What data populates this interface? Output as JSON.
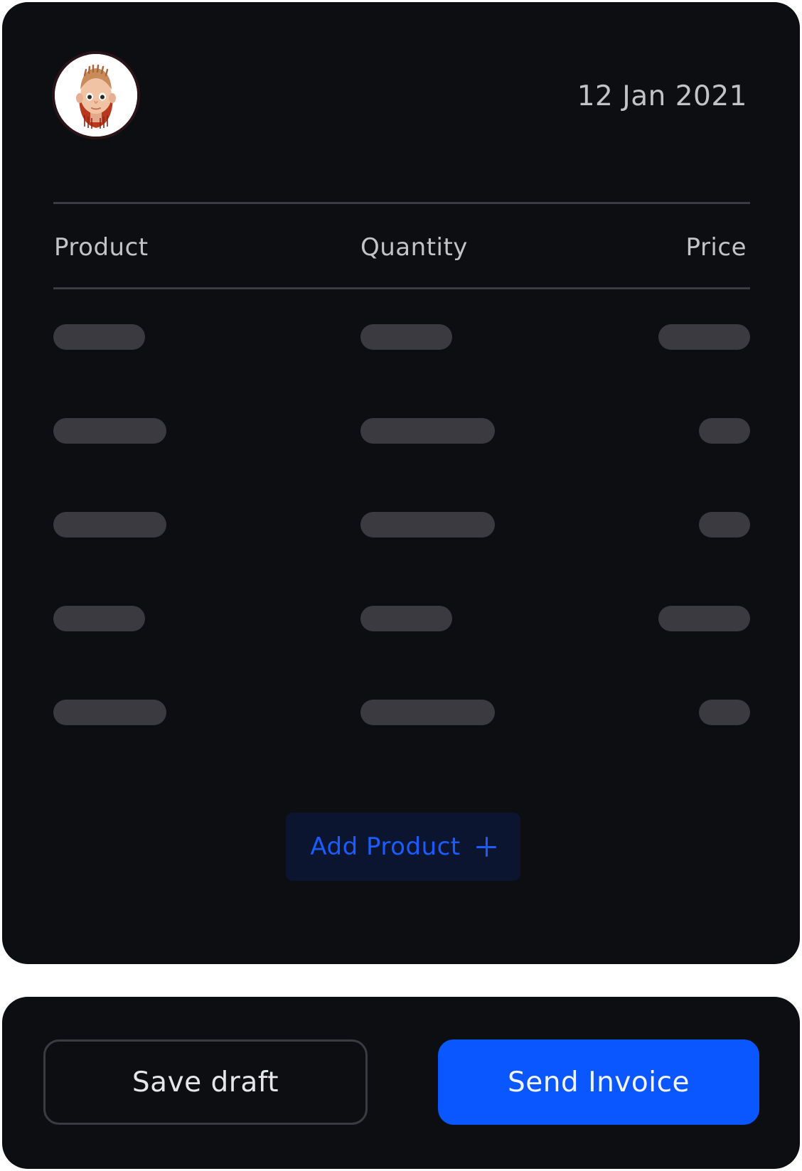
{
  "invoice": {
    "date": "12 Jan 2021",
    "avatar_alt": "",
    "columns": {
      "product": "Product",
      "quantity": "Quantity",
      "price": "Price"
    },
    "rows_state": "loading-placeholder",
    "add_product_label": "Add Product"
  },
  "actions": {
    "save_label": "Save draft",
    "send_label": "Send Invoice"
  },
  "colors": {
    "background": "#0d0e12",
    "accent": "#0a57ff",
    "placeholder": "#3a3a40",
    "add_button_bg": "#0b1530"
  }
}
